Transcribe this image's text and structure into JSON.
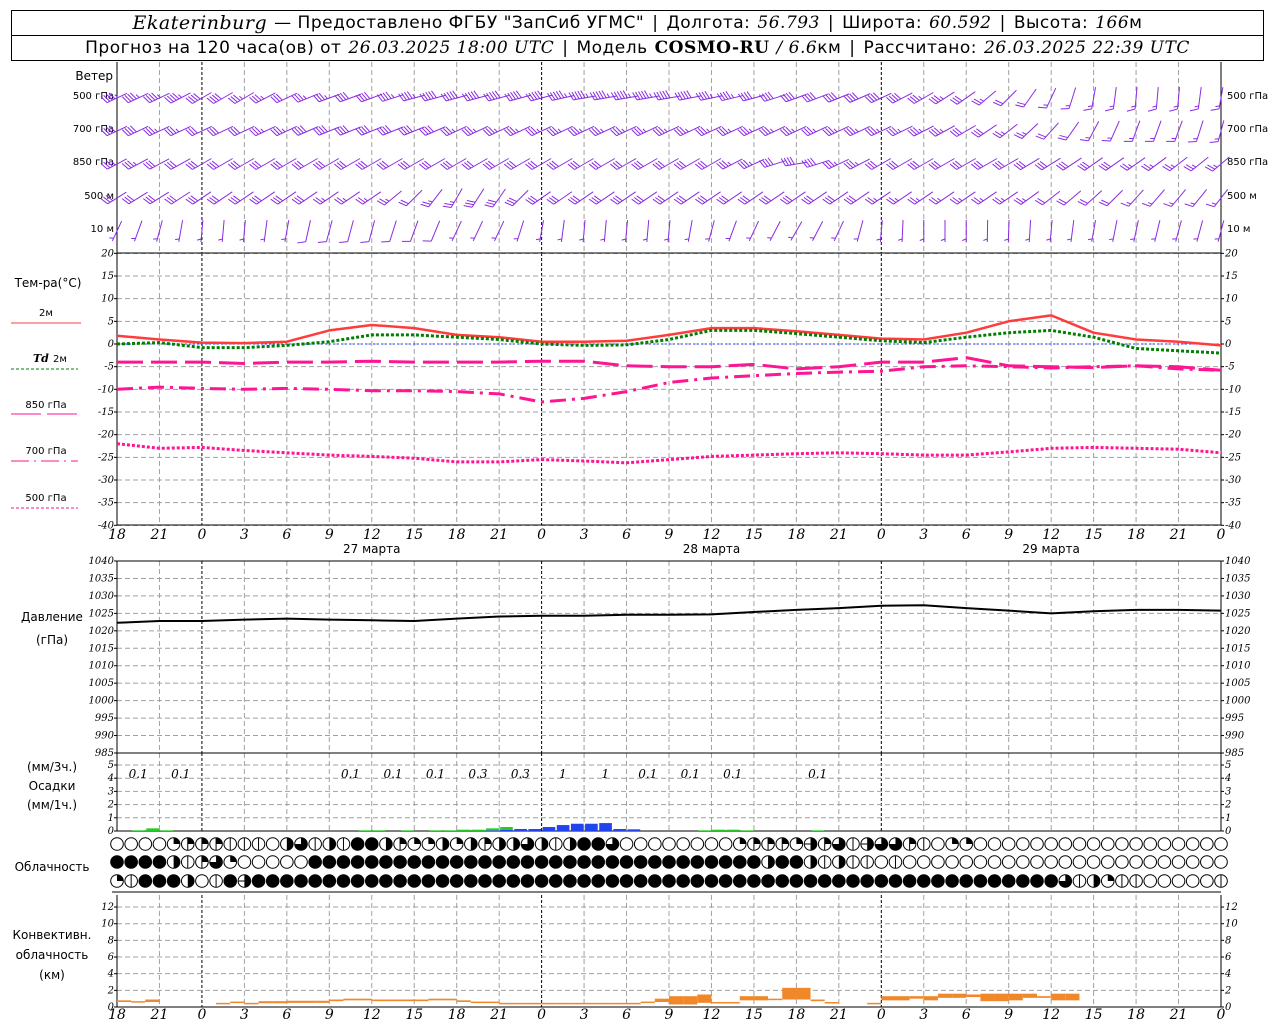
{
  "header": {
    "station": "Ekaterinburg",
    "provider": "— Предоставлено ФГБУ \"ЗапСиб УГМС\"",
    "lon_label": "Долгота:",
    "lon": "56.793",
    "lat_label": "Широта:",
    "lat": "60.592",
    "alt_label": "Высота:",
    "alt": "166",
    "alt_unit": "м",
    "forecast_prefix": "Прогноз на 120 часа(ов) от",
    "forecast_time": "26.03.2025 18:00 UTC",
    "model_label": "Модель",
    "model": "COSMO-RU",
    "resolution": "/ 6.6",
    "resolution_unit": "км",
    "calc_label": "Рассчитано:",
    "calc_time": "26.03.2025 22:39 UTC"
  },
  "labels": {
    "wind": "Ветер",
    "temp": "Тем-ра(°C)",
    "t2m": "2м",
    "td_prefix": "Td",
    "td2m": "2м",
    "t850": "850 гПа",
    "t700": "700 гПа",
    "t500": "500 гПа",
    "pressure": "Давление",
    "pressure_unit": "(гПа)",
    "precip_3h": "(мм/3ч.)",
    "precip": "Осадки",
    "precip_1h": "(мм/1ч.)",
    "clouds": "Облачность",
    "conv1": "Конвективн.",
    "conv2": "облачность",
    "conv3": "(км)"
  },
  "colors": {
    "wind": "#8a2be2",
    "t2m": "#ff3b3b",
    "td2m": "#008000",
    "upper_temp": "#ff1493",
    "zero_line": "#2040ff",
    "rain": "#22cc22",
    "snow": "#2244ee",
    "convective": "#f0882a",
    "grid": "#a0a0a0"
  },
  "chart_data": {
    "type": "meteogram",
    "start_time": "26.03.2025 18:00 UTC",
    "step_hours": 1,
    "time_ticks": [
      "18",
      "21",
      "0",
      "3",
      "6",
      "9",
      "12",
      "15",
      "18",
      "21",
      "0",
      "3",
      "6",
      "9",
      "12",
      "15",
      "18",
      "21",
      "0",
      "3",
      "6",
      "9",
      "12",
      "15",
      "18",
      "21",
      "0"
    ],
    "date_labels": [
      "27 марта",
      "28 марта",
      "29 марта"
    ],
    "wind": {
      "units": "kt",
      "levels": [
        {
          "name": "500 гПа",
          "dir": [
            245,
            245,
            240,
            240,
            245,
            250,
            250,
            255,
            255,
            255,
            255,
            260,
            260,
            260,
            258,
            255,
            250,
            248,
            245,
            240,
            235,
            225,
            205,
            190,
            185,
            185,
            190
          ],
          "speed": [
            45,
            45,
            40,
            35,
            30,
            35,
            40,
            45,
            50,
            50,
            50,
            55,
            55,
            50,
            45,
            40,
            40,
            40,
            40,
            35,
            30,
            20,
            15,
            15,
            15,
            15,
            15
          ]
        },
        {
          "name": "700 гПа",
          "dir": [
            245,
            245,
            245,
            245,
            245,
            248,
            248,
            248,
            245,
            245,
            245,
            245,
            245,
            245,
            245,
            245,
            245,
            245,
            245,
            243,
            240,
            232,
            222,
            208,
            200,
            200,
            195
          ],
          "speed": [
            40,
            35,
            30,
            30,
            35,
            40,
            40,
            40,
            35,
            35,
            35,
            35,
            35,
            35,
            35,
            35,
            35,
            35,
            35,
            35,
            30,
            25,
            20,
            15,
            15,
            15,
            15
          ]
        },
        {
          "name": "850 гПа",
          "dir": [
            242,
            242,
            240,
            240,
            240,
            240,
            240,
            240,
            240,
            240,
            240,
            240,
            240,
            240,
            240,
            245,
            260,
            245,
            240,
            240,
            240,
            240,
            238,
            235,
            235,
            232,
            230
          ],
          "speed": [
            35,
            30,
            30,
            30,
            30,
            30,
            30,
            30,
            30,
            30,
            30,
            30,
            30,
            30,
            30,
            35,
            40,
            35,
            30,
            30,
            30,
            30,
            30,
            30,
            25,
            25,
            25
          ]
        },
        {
          "name": "500 м",
          "dir": [
            238,
            238,
            236,
            236,
            236,
            236,
            236,
            225,
            210,
            215,
            235,
            236,
            236,
            236,
            236,
            236,
            236,
            236,
            236,
            236,
            236,
            236,
            232,
            228,
            222,
            220,
            218
          ],
          "speed": [
            30,
            30,
            30,
            30,
            30,
            25,
            25,
            20,
            25,
            30,
            30,
            30,
            30,
            30,
            30,
            30,
            30,
            30,
            25,
            25,
            25,
            25,
            20,
            20,
            15,
            15,
            15
          ]
        },
        {
          "name": "10 м",
          "dir": [
            205,
            195,
            185,
            185,
            190,
            195,
            195,
            200,
            205,
            205,
            190,
            185,
            185,
            185,
            195,
            205,
            210,
            205,
            185,
            180,
            180,
            182,
            185,
            190,
            192,
            195,
            195
          ],
          "speed": [
            5,
            5,
            5,
            5,
            5,
            10,
            10,
            10,
            5,
            5,
            5,
            5,
            5,
            5,
            5,
            5,
            5,
            5,
            5,
            5,
            5,
            5,
            5,
            5,
            5,
            5,
            5
          ]
        }
      ]
    },
    "temperature": {
      "ylim": [
        -40,
        20
      ],
      "yticks": [
        20,
        15,
        10,
        5,
        0,
        -5,
        -10,
        -15,
        -20,
        -25,
        -30,
        -35,
        -40
      ],
      "series": [
        {
          "name": "2м",
          "values": [
            1.8,
            1.0,
            0.3,
            0.2,
            0.5,
            3.0,
            4.2,
            3.5,
            2.0,
            1.5,
            0.5,
            0.5,
            0.7,
            2.0,
            3.5,
            3.5,
            2.8,
            2.0,
            1.2,
            1.0,
            2.5,
            5.0,
            6.3,
            2.5,
            1.0,
            0.5,
            -0.3
          ]
        },
        {
          "name": "Td 2м",
          "values": [
            0.0,
            0.3,
            -0.8,
            -0.8,
            -0.3,
            0.5,
            2.0,
            2.0,
            1.5,
            1.0,
            0.0,
            -0.3,
            -0.2,
            1.0,
            3.0,
            3.0,
            2.3,
            1.5,
            0.7,
            0.3,
            1.5,
            2.5,
            3.0,
            1.5,
            -1.0,
            -1.5,
            -2.0
          ]
        },
        {
          "name": "850 гПа",
          "values": [
            -4.0,
            -4.0,
            -4.0,
            -4.3,
            -4.0,
            -4.0,
            -3.8,
            -4.0,
            -4.0,
            -4.0,
            -3.8,
            -3.8,
            -4.8,
            -5.0,
            -5.0,
            -4.5,
            -5.5,
            -5.0,
            -4.0,
            -4.0,
            -3.0,
            -4.8,
            -5.0,
            -5.2,
            -4.8,
            -5.0,
            -5.8
          ]
        },
        {
          "name": "700 гПа",
          "values": [
            -10.0,
            -9.5,
            -9.8,
            -10.0,
            -9.8,
            -10.0,
            -10.3,
            -10.3,
            -10.5,
            -11.0,
            -12.8,
            -12.0,
            -10.5,
            -8.5,
            -7.5,
            -7.0,
            -6.5,
            -6.2,
            -6.0,
            -5.0,
            -4.8,
            -5.0,
            -5.3,
            -5.0,
            -4.8,
            -5.5,
            -5.8
          ]
        },
        {
          "name": "500 гПа",
          "values": [
            -22.0,
            -23.0,
            -22.8,
            -23.5,
            -24.0,
            -24.5,
            -24.8,
            -25.2,
            -26.0,
            -26.0,
            -25.5,
            -25.8,
            -26.2,
            -25.5,
            -24.8,
            -24.5,
            -24.2,
            -24.0,
            -24.2,
            -24.5,
            -24.5,
            -23.8,
            -23.0,
            -22.8,
            -23.0,
            -23.2,
            -24.0
          ]
        }
      ]
    },
    "pressure": {
      "ylim": [
        985,
        1040
      ],
      "yticks": [
        1040,
        1035,
        1030,
        1025,
        1020,
        1015,
        1010,
        1005,
        1000,
        995,
        990,
        985
      ],
      "values": [
        1022.3,
        1022.8,
        1022.8,
        1023.2,
        1023.5,
        1023.2,
        1023.0,
        1022.8,
        1023.5,
        1024.1,
        1024.3,
        1024.3,
        1024.6,
        1024.6,
        1024.7,
        1025.4,
        1026.0,
        1026.5,
        1027.2,
        1027.3,
        1026.5,
        1025.8,
        1025.0,
        1025.6,
        1026.0,
        1026.0,
        1025.8
      ]
    },
    "precipitation": {
      "ylim": [
        0,
        5
      ],
      "yticks": [
        5,
        4,
        3,
        2,
        1,
        0
      ],
      "totals_3h": [
        "0.1",
        "0.1",
        "",
        "",
        "",
        "0.1",
        "0.1",
        "0.1",
        "0.3",
        "0.3",
        "1",
        "1",
        "0.1",
        "0.1",
        "0.1",
        "",
        "0.1",
        "",
        "",
        "",
        "",
        "",
        "",
        "",
        "",
        ""
      ],
      "rain_1h": [
        0,
        0.05,
        0.2,
        0.05,
        0,
        0,
        0,
        0,
        0,
        0,
        0,
        0,
        0,
        0,
        0,
        0,
        0,
        0.05,
        0.05,
        0,
        0.05,
        0,
        0.05,
        0.05,
        0.1,
        0.1,
        0.15,
        0.2,
        0,
        0,
        0,
        0,
        0,
        0,
        0,
        0,
        0.05,
        0,
        0,
        0,
        0,
        0.05,
        0.1,
        0.1,
        0.05,
        0,
        0,
        0,
        0,
        0.05,
        0,
        0,
        0,
        0,
        0,
        0,
        0,
        0,
        0,
        0,
        0,
        0,
        0,
        0,
        0,
        0,
        0,
        0,
        0,
        0,
        0,
        0,
        0,
        0,
        0,
        0,
        0,
        0
      ],
      "snow_1h": [
        0,
        0,
        0,
        0,
        0,
        0,
        0,
        0,
        0,
        0,
        0,
        0,
        0,
        0,
        0,
        0,
        0,
        0,
        0,
        0,
        0,
        0,
        0,
        0,
        0,
        0,
        0.05,
        0.1,
        0.15,
        0.15,
        0.3,
        0.45,
        0.55,
        0.55,
        0.6,
        0.15,
        0.1,
        0,
        0,
        0,
        0,
        0,
        0,
        0,
        0,
        0,
        0,
        0,
        0,
        0,
        0,
        0,
        0,
        0,
        0,
        0,
        0,
        0,
        0,
        0,
        0,
        0,
        0,
        0,
        0,
        0,
        0,
        0,
        0,
        0,
        0,
        0,
        0,
        0,
        0,
        0,
        0,
        0,
        0
      ]
    },
    "cloudiness_octas": {
      "rows": [
        "0000233311104614188432242434464148860000000023332536156631022000000000000000000",
        "8888413620000088888888888888888888888888888888488414110100000000000000000000000",
        "2188840185888888888888888888888888888888888888888888888888888888888614211000001000003"
      ]
    },
    "convective": {
      "units": "км",
      "ylim": [
        0,
        13.4
      ],
      "yticks": [
        12,
        10,
        8,
        6,
        4,
        2,
        0
      ],
      "layers_1h": [
        [
          0.6,
          0.8
        ],
        [
          0.55,
          0.7
        ],
        [
          0.6,
          0.9
        ],
        null,
        null,
        null,
        null,
        [
          0.4,
          0.5
        ],
        [
          0.5,
          0.65
        ],
        [
          0.4,
          0.5
        ],
        [
          0.45,
          0.7
        ],
        [
          0.45,
          0.7
        ],
        [
          0.5,
          0.75
        ],
        [
          0.5,
          0.75
        ],
        [
          0.5,
          0.75
        ],
        [
          0.7,
          0.9
        ],
        [
          0.8,
          1.0
        ],
        [
          0.8,
          1.0
        ],
        [
          0.7,
          0.9
        ],
        [
          0.7,
          0.9
        ],
        [
          0.7,
          0.9
        ],
        [
          0.7,
          0.9
        ],
        [
          0.8,
          1.0
        ],
        [
          0.8,
          1.0
        ],
        [
          0.6,
          0.8
        ],
        [
          0.55,
          0.65
        ],
        [
          0.55,
          0.65
        ],
        [
          0.4,
          0.5
        ],
        [
          0.4,
          0.5
        ],
        [
          0.4,
          0.5
        ],
        [
          0.4,
          0.5
        ],
        [
          0.4,
          0.5
        ],
        [
          0.4,
          0.5
        ],
        [
          0.4,
          0.5
        ],
        [
          0.4,
          0.5
        ],
        [
          0.4,
          0.5
        ],
        [
          0.4,
          0.5
        ],
        [
          0.5,
          0.65
        ],
        [
          0.6,
          1.0
        ],
        [
          0.3,
          1.3
        ],
        [
          0.3,
          1.3
        ],
        [
          0.5,
          1.5
        ],
        [
          0.55,
          0.6
        ],
        [
          0.55,
          0.6
        ],
        [
          0.8,
          1.3
        ],
        [
          0.8,
          1.3
        ],
        [
          0.9,
          1.0
        ],
        [
          0.9,
          2.3
        ],
        [
          0.9,
          2.3
        ],
        [
          0.7,
          0.9
        ],
        [
          0.55,
          0.6
        ],
        null,
        null,
        [
          0.4,
          0.5
        ],
        [
          0.8,
          1.3
        ],
        [
          0.8,
          1.3
        ],
        [
          1.0,
          1.3
        ],
        [
          0.8,
          1.3
        ],
        [
          1.1,
          1.6
        ],
        [
          1.1,
          1.6
        ],
        [
          1.2,
          1.5
        ],
        [
          0.7,
          1.6
        ],
        [
          0.7,
          1.6
        ],
        [
          0.8,
          1.6
        ],
        [
          1.1,
          1.6
        ],
        [
          1.1,
          1.3
        ],
        [
          0.8,
          1.6
        ],
        [
          0.8,
          1.6
        ],
        null,
        null,
        null,
        null,
        null,
        null,
        null,
        null,
        null,
        null
      ]
    }
  }
}
